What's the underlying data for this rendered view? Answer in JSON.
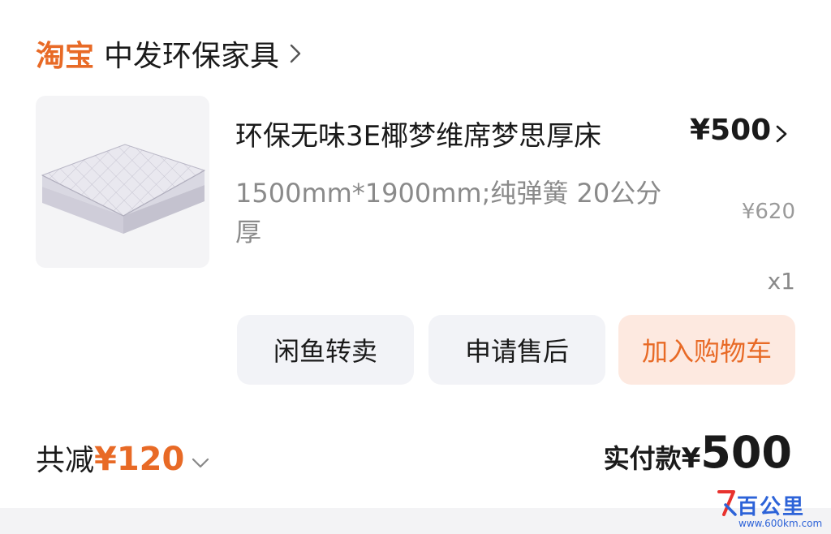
{
  "store": {
    "brand": "淘宝",
    "name": "中发环保家具"
  },
  "product": {
    "title": "环保无味3E椰梦维席梦思厚床",
    "price": "¥500",
    "spec": "1500mm*1900mm;纯弹簧 20公分厚",
    "original_price": "¥620",
    "quantity": "x1"
  },
  "actions": {
    "resell_label": "闲鱼转卖",
    "aftersale_label": "申请售后",
    "add_to_cart_label": "加入购物车"
  },
  "summary": {
    "discount_label": "共减",
    "discount_value": "¥120",
    "paid_label": "实付款",
    "paid_currency": "¥",
    "paid_value": "500"
  },
  "watermark": {
    "text": "百公里",
    "url": "www.600km.com"
  },
  "colors": {
    "accent": "#e86a26",
    "accent_bg": "#fde9e0",
    "button_bg": "#f2f3f7",
    "muted_text": "#8a8a8a",
    "watermark": "#2d63d8"
  },
  "icons": {
    "store_chevron": "chevron-right-icon",
    "price_chevron": "chevron-right-icon",
    "discount_chevron": "chevron-down-icon",
    "thumbnail": "mattress-image"
  }
}
